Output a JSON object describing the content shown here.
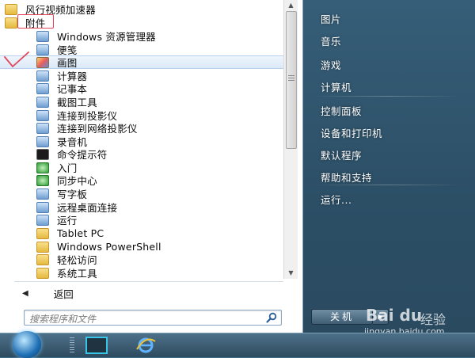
{
  "programs": [
    {
      "label": "风行视频加速器",
      "icon": "folder-icon",
      "level": 0
    },
    {
      "label": "附件",
      "icon": "folder-icon",
      "level": 0
    },
    {
      "label": "Windows 资源管理器",
      "icon": "explorer-icon",
      "level": 1
    },
    {
      "label": "便笺",
      "icon": "sticky-notes-icon",
      "level": 1
    },
    {
      "label": "画图",
      "icon": "paint-icon",
      "level": 1,
      "selected": true
    },
    {
      "label": "计算器",
      "icon": "calculator-icon",
      "level": 1
    },
    {
      "label": "记事本",
      "icon": "notepad-icon",
      "level": 1
    },
    {
      "label": "截图工具",
      "icon": "snipping-tool-icon",
      "level": 1
    },
    {
      "label": "连接到投影仪",
      "icon": "projector-icon",
      "level": 1
    },
    {
      "label": "连接到网络投影仪",
      "icon": "network-projector-icon",
      "level": 1
    },
    {
      "label": "录音机",
      "icon": "sound-recorder-icon",
      "level": 1
    },
    {
      "label": "命令提示符",
      "icon": "command-prompt-icon",
      "level": 1
    },
    {
      "label": "入门",
      "icon": "getting-started-icon",
      "level": 1
    },
    {
      "label": "同步中心",
      "icon": "sync-center-icon",
      "level": 1
    },
    {
      "label": "写字板",
      "icon": "wordpad-icon",
      "level": 1
    },
    {
      "label": "远程桌面连接",
      "icon": "remote-desktop-icon",
      "level": 1
    },
    {
      "label": "运行",
      "icon": "run-icon",
      "level": 1
    },
    {
      "label": "Tablet PC",
      "icon": "folder-icon",
      "level": 1
    },
    {
      "label": "Windows PowerShell",
      "icon": "folder-icon",
      "level": 1
    },
    {
      "label": "轻松访问",
      "icon": "folder-icon",
      "level": 1
    },
    {
      "label": "系统工具",
      "icon": "folder-icon",
      "level": 1
    }
  ],
  "back": {
    "label": "返回"
  },
  "search": {
    "placeholder": "搜索程序和文件"
  },
  "right_menu": [
    "图片",
    "音乐",
    "游戏",
    "计算机",
    "控制面板",
    "设备和打印机",
    "默认程序",
    "帮助和支持",
    "运行..."
  ],
  "shutdown": {
    "label": "关机"
  },
  "watermark": {
    "logo": "Bai du",
    "brand": "经验",
    "url": "jingyan.baidu.com"
  },
  "colors": {
    "highlight_red": "#e2455a",
    "right_panel": "#2c4f66",
    "selection": "#dbe9f8"
  }
}
